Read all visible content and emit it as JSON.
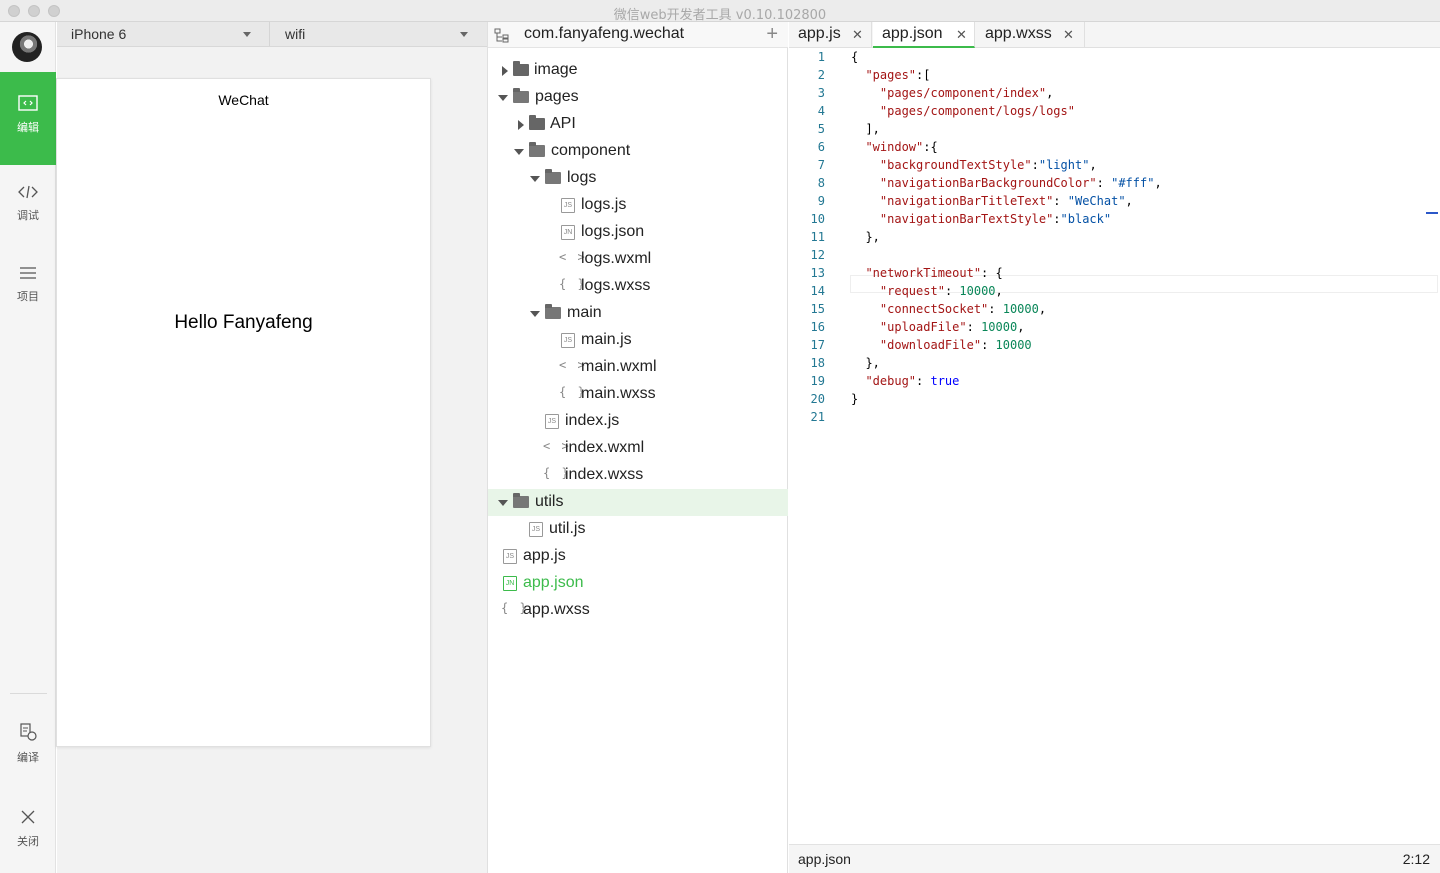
{
  "window": {
    "title": "微信web开发者工具 v0.10.102800"
  },
  "sidebar": {
    "items": [
      {
        "label": "编辑",
        "icon": "code-screen-icon",
        "active": true
      },
      {
        "label": "调试",
        "icon": "code-brackets-icon"
      },
      {
        "label": "项目",
        "icon": "menu-lines-icon"
      },
      {
        "label": "编译",
        "icon": "compile-icon"
      },
      {
        "label": "关闭",
        "icon": "close-icon"
      }
    ],
    "accent": "#3cbb4b"
  },
  "simulator": {
    "device": "iPhone 6",
    "network": "wifi",
    "nav_title": "WeChat",
    "body_text": "Hello Fanyafeng"
  },
  "project": {
    "name": "com.fanyafeng.wechat",
    "tree": [
      {
        "label": "image",
        "type": "folder",
        "open": false
      },
      {
        "label": "pages",
        "type": "folder",
        "open": true
      },
      {
        "label": "API",
        "type": "folder",
        "open": false
      },
      {
        "label": "component",
        "type": "folder",
        "open": true
      },
      {
        "label": "logs",
        "type": "folder",
        "open": true
      },
      {
        "label": "logs.js",
        "type": "js",
        "tag": "JS"
      },
      {
        "label": "logs.json",
        "type": "json",
        "tag": "JN"
      },
      {
        "label": "logs.wxml",
        "type": "wxml",
        "tag": "< >"
      },
      {
        "label": "logs.wxss",
        "type": "wxss",
        "tag": "{ }"
      },
      {
        "label": "main",
        "type": "folder",
        "open": true
      },
      {
        "label": "main.js",
        "type": "js",
        "tag": "JS"
      },
      {
        "label": "main.wxml",
        "type": "wxml",
        "tag": "< >"
      },
      {
        "label": "main.wxss",
        "type": "wxss",
        "tag": "{ }"
      },
      {
        "label": "index.js",
        "type": "js",
        "tag": "JS"
      },
      {
        "label": "index.wxml",
        "type": "wxml",
        "tag": "< >"
      },
      {
        "label": "index.wxss",
        "type": "wxss",
        "tag": "{ }"
      },
      {
        "label": "utils",
        "type": "folder",
        "open": true,
        "selected": true
      },
      {
        "label": "util.js",
        "type": "js",
        "tag": "JS"
      },
      {
        "label": "app.js",
        "type": "js",
        "tag": "JS"
      },
      {
        "label": "app.json",
        "type": "json",
        "tag": "JN",
        "active": true
      },
      {
        "label": "app.wxss",
        "type": "wxss",
        "tag": "{ }"
      }
    ]
  },
  "editor": {
    "tabs": [
      {
        "label": "app.js"
      },
      {
        "label": "app.json",
        "active": true
      },
      {
        "label": "app.wxss"
      }
    ],
    "line_numbers": [
      "1",
      "2",
      "3",
      "4",
      "5",
      "6",
      "7",
      "8",
      "9",
      "10",
      "11",
      "12",
      "13",
      "14",
      "15",
      "16",
      "17",
      "18",
      "19",
      "20",
      "21"
    ],
    "status_file": "app.json",
    "status_pos": "2:12"
  }
}
